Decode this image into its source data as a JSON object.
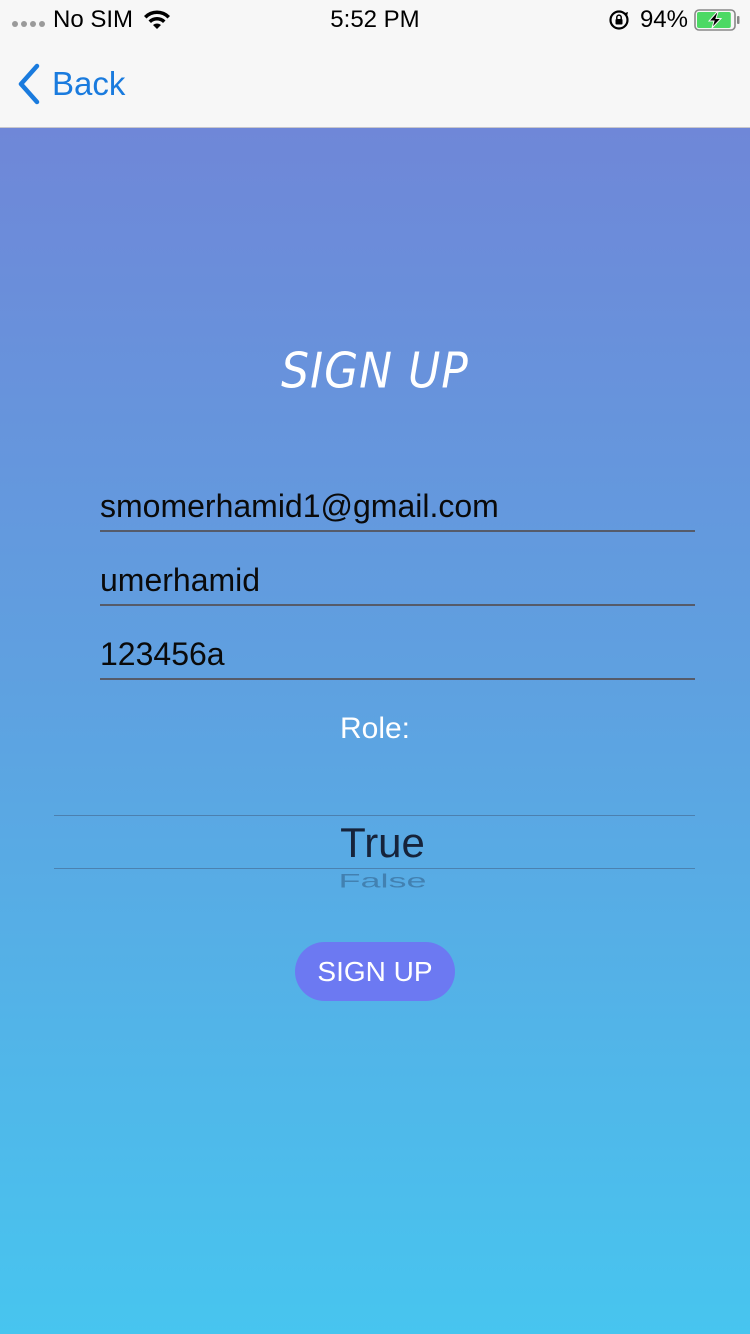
{
  "status_bar": {
    "carrier": "No SIM",
    "time": "5:52 PM",
    "battery_percent": "94%",
    "battery_level": 0.94,
    "icons": [
      "signal-dots-icon",
      "wifi-icon",
      "lock-rotation-icon",
      "battery-charging-icon"
    ]
  },
  "nav": {
    "back_label": "Back",
    "back_icon": "chevron-left-icon",
    "accent_color": "#1a7bde"
  },
  "form": {
    "title": "SIGN UP",
    "email_value": "smomerhamid1@gmail.com",
    "username_value": "umerhamid",
    "password_value": "123456a",
    "role_label": "Role:",
    "role_picker": {
      "selected": "True",
      "next": "False"
    },
    "submit_label": "SIGN UP",
    "submit_color": "#6c79f2"
  },
  "colors": {
    "gradient_top": "#6f87d8",
    "gradient_bottom": "#47c5ef"
  }
}
